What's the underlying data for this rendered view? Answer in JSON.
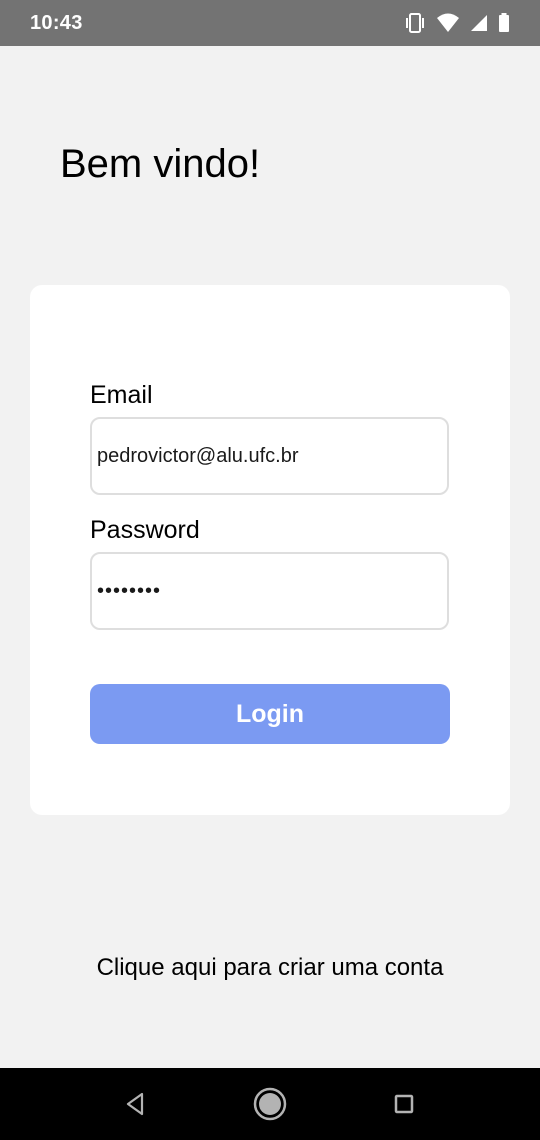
{
  "status_bar": {
    "time": "10:43",
    "icons": [
      "vibrate-icon",
      "wifi-icon",
      "cell-signal-icon",
      "battery-icon"
    ]
  },
  "page": {
    "title": "Bem vindo!"
  },
  "login_form": {
    "email_label": "Email",
    "email_value": "pedrovictor@alu.ufc.br",
    "password_label": "Password",
    "password_value": "••••••••",
    "login_button_label": "Login"
  },
  "footer": {
    "create_account_link": "Clique aqui para criar uma conta"
  },
  "nav_bar": {
    "buttons": [
      "back-icon",
      "home-icon",
      "recents-icon"
    ]
  },
  "colors": {
    "status_bar_bg": "#737373",
    "page_bg": "#f2f2f2",
    "card_bg": "#ffffff",
    "login_button_bg": "#7b9af2",
    "nav_bar_bg": "#000000"
  }
}
